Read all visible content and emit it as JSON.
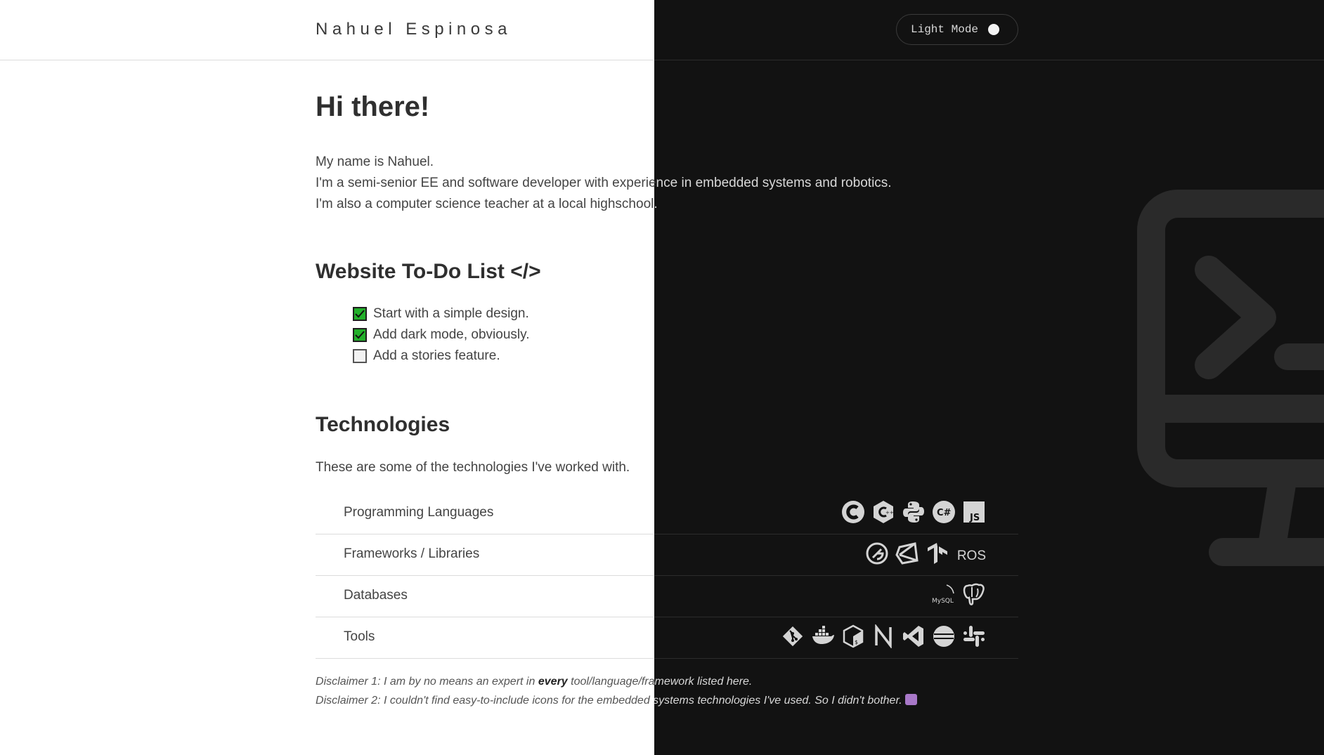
{
  "header": {
    "brand": "Nahuel Espinosa",
    "mode_toggle": {
      "label": "Light Mode",
      "icon": "toggle-knob-icon"
    }
  },
  "hero": {
    "title": "Hi there!",
    "intro_lines": [
      "My name is Nahuel.",
      "I'm a semi-senior EE and software developer with experience in embedded systems and robotics.",
      "I'm also a computer science teacher at a local highschool."
    ]
  },
  "todo": {
    "title": "Website To-Do List </>",
    "items": [
      {
        "label": "Start with a simple design.",
        "checked": true
      },
      {
        "label": "Add dark mode, obviously.",
        "checked": true
      },
      {
        "label": "Add a stories feature.",
        "checked": false
      }
    ]
  },
  "technologies": {
    "title": "Technologies",
    "intro": "These are some of the technologies I've worked with.",
    "rows": [
      {
        "label": "Programming Languages",
        "icons": [
          "c-icon",
          "cpp-icon",
          "python-icon",
          "csharp-icon",
          "javascript-icon"
        ]
      },
      {
        "label": "Frameworks / Libraries",
        "icons": [
          "gatsby-icon",
          "unity-icon",
          "tensorflow-icon"
        ],
        "trailing_text": "ROS"
      },
      {
        "label": "Databases",
        "icons": [
          "mysql-icon",
          "postgresql-icon"
        ],
        "mysql_text": "MySQL"
      },
      {
        "label": "Tools",
        "icons": [
          "git-icon",
          "docker-icon",
          "bash-icon",
          "nextjs-icon",
          "vscode-icon",
          "eclipse-icon",
          "slack-icon"
        ]
      }
    ]
  },
  "disclaimers": {
    "line1_before": "Disclaimer 1: I am by no means an expert in ",
    "line1_bold": "every",
    "line1_after": " tool/language/framework listed here.",
    "line2": "Disclaimer 2: I couldn't find easy-to-include icons for the embedded systems technologies I've used. So I didn't bother.",
    "emoji": "woman-shrugging-emoji"
  },
  "colors": {
    "light_bg": "#ffffff",
    "dark_bg": "#121212",
    "check_green": "#22b02a",
    "icon_light": "#d4d4d4",
    "illustration": "#2a2a2a"
  }
}
